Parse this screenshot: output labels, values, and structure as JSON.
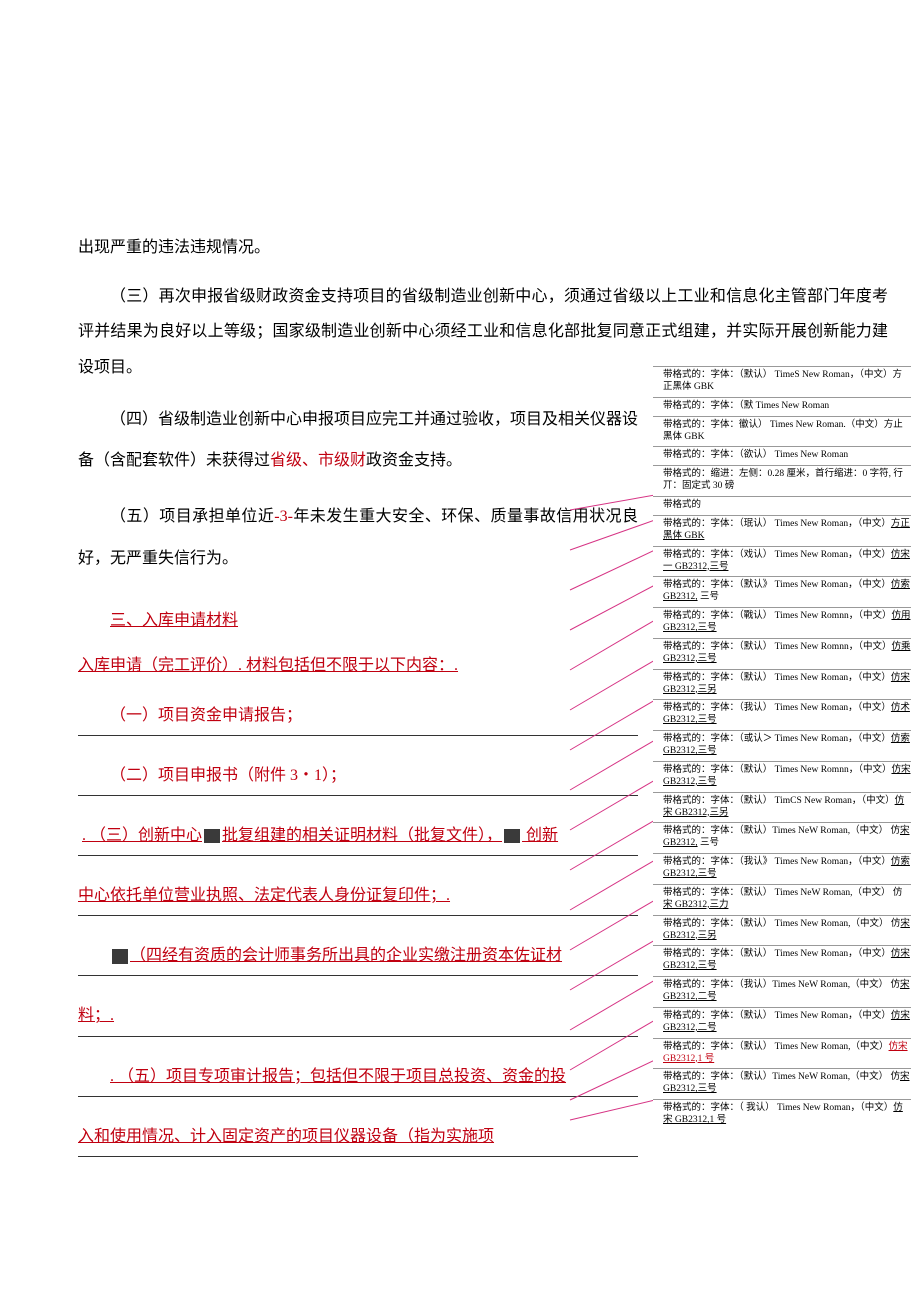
{
  "body": {
    "p1": "出现严重的违法违规情况。",
    "p2": "（三）再次申报省级财政资金支持项目的省级制造业创新中心，须通过省级以上工业和信息化主管部门年度考评并结果为良好以上等级；国家级制造业创新中心须经工业和信息化部批复同意正式组建，并实际开展创新能力建设项目。",
    "p3": "（四）省级制造业创新中心申报项目应完工并通过验收，项目及相关仪器设备（含配套软件）未获得过",
    "p3_red": "省级、市级财",
    "p3_tail": "政资金支持。",
    "p4_a": "（五）项目承担单位近",
    "p4_red": "-3-",
    "p4_b": "年未发生重大安全、环保、质量事故信用状况良好，无严重失信行为。",
    "heading": "三、入库申请材料",
    "intro": "入库申请（完工评价）. 材料包括但不限于以下内容：.",
    "item1": "（一）项目资金申请报告；",
    "item2": "（二）项目申报书（附件 3・1）；",
    "item3_a": ". （三）创新中心",
    "item3_b": "批复组建的相关证明材料（批复文件），",
    "item3_c": " 创新",
    "item3_line2": "中心依托单位营业执照、法定代表人身份证复印件；.",
    "item4_a": "（四经有资质的会计师事务所出具的企业实缴注册资本佐证材",
    "item4_b": "料；.",
    "item5_a": ". （五）项目专项审计报告；包括但不限于项目总投资、资金的投",
    "item5_b": "入和使用情况、计入固定资产的项目仪器设备（指为实施项"
  },
  "comments": [
    {
      "text": "带格式的：字体：（默认） TimeS New Roman，（中文）方正黑体 GBK"
    },
    {
      "text": "带格式的：字体：（默    Times  New Roman"
    },
    {
      "text": "带格式的：字体：徽认）   Times  New Roman.（中文）方止黑体 GBK"
    },
    {
      "text": "带格式的：字体：（欲认） Times  New Roman"
    },
    {
      "text": "带格式的：缩进：左侧：0.28 厘米，首行缩进：0 字符, 行丌：固定式 30 磅"
    },
    {
      "text": "带格式的"
    },
    {
      "text": "带格式的：字体：（珉认） Times New Roman，（中文）方正黑体 GBK",
      "underline": "方正黑体 GBK"
    },
    {
      "text": "带格式的：字体：（戏认） Times New Roman，（中文）仿宋一 GB2312,三号",
      "underline": "仿宋一 GB2312,三号"
    },
    {
      "text": "带格式的：字体：（默认》 Times New Roman，（中文）仿索 GB2312, 三号",
      "underline": "仿索 GB2312,"
    },
    {
      "text": "带格式的：字体：（戰认） Times New Romnn，（中文）仿用 GB2312,三号",
      "underline": "仿用 GB2312,三号"
    },
    {
      "text": "带格式的：字体：（默认） Times New Romnn，（中文）仿乘 GB2312,三号",
      "underline": "仿乘 GB2312,三号"
    },
    {
      "text": "带格式的：字体：（默认） Times New Roman，（中文）仿宋 GB2312,三另",
      "underline": "仿宋 GB2312,三另"
    },
    {
      "text": "带格式的：字体：（我认） Times New Roman，（中文）仿术 GB2312,三号",
      "underline": "仿术 GB2312,三号"
    },
    {
      "text": "带格式的：字体：（或认＞ Times New Roman，（中文）仿索 GB2312,三号",
      "underline": "仿索 GB2312,三号"
    },
    {
      "text": "带格式的：字体：（默认） Times New Romnn，（中文）仿宋 GB2312,三号",
      "underline": "仿宋 GB2312,三号"
    },
    {
      "text": "带格式的：字体：（默认） TimCS New Roman，（中文）仿宋 GB2312,三另",
      "underline": "仿宋 GB2312,三另"
    },
    {
      "text": "带格式的：字体：（默认）Times NeW Roman,（中文） 仿宋 GB2312, 三号",
      "underline": "宋 GB2312,"
    },
    {
      "text": "带格式的：字体：（我认》 Times New Roman，（中文）仿索 GB2312,三号",
      "underline": "仿索 GB2312,三号"
    },
    {
      "text": "带格式的：字体：（默认） Times NeW Roman,（中文） 仿宋 GB2312,三力",
      "underline": "宋 GB2312,三力"
    },
    {
      "text": "带格式的：字体：（默认） Times New Roman,（中文） 仿宋 GB2312,三另",
      "underline": "宋 GB2312,三另"
    },
    {
      "text": "带格式的：字体：（默认） Times New Roman，（中文）仿宋 GB2312,三号",
      "underline": "仿宋 GB2312,三号"
    },
    {
      "text": "带格式的：字体：（我认）Times NeW Roman,（中文） 仿宋 GB2312,二号",
      "underline": "宋 GB2312,二号"
    },
    {
      "text": "带格式的：字体：（默认） Times New Roman，（中文）仿宋 GB2312,二号",
      "underline": "仿宋 GB2312,二号"
    },
    {
      "text": "带格式的：字体：（默认）  Times New Roman,（中文）仿宋 GB2312,1 号",
      "underline": "仿宋 GB2312,1 号",
      "red": true
    },
    {
      "text": "带格式的：字体：（默认）Times NeW Roman,（中文） 仿宋 GB2312,三号",
      "underline": "宋 GB2312,三号"
    },
    {
      "text": "带格式的：字体：（ 我认） Times New Roman，（中文）仿宋 GB2312,1 号",
      "underline": "仿宋 GB2312,1 号"
    }
  ]
}
